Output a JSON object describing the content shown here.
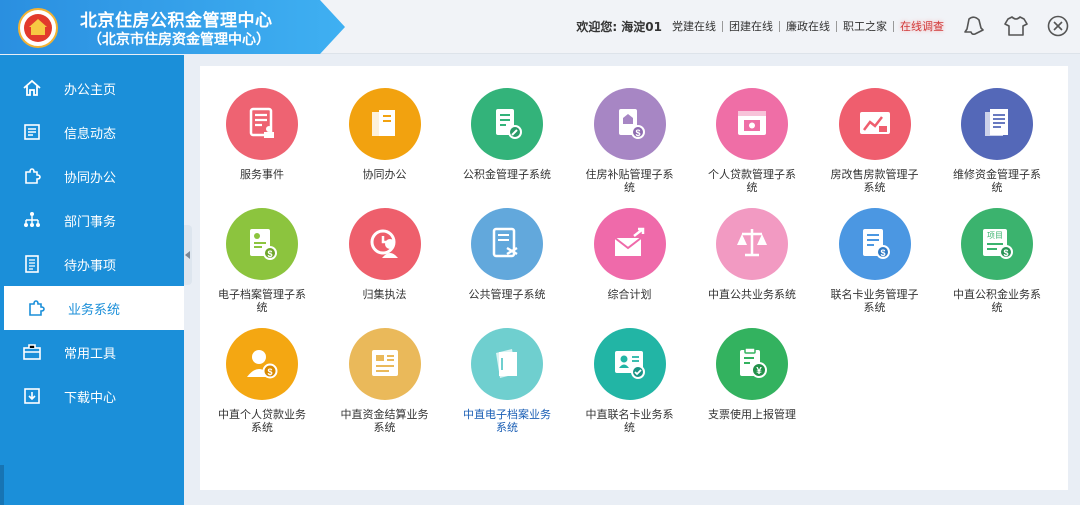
{
  "header": {
    "title": "北京住房公积金管理中心",
    "subtitle": "（北京市住房资金管理中心）",
    "welcome": "欢迎您: 海淀01",
    "links": [
      "党建在线",
      "团建在线",
      "廉政在线",
      "职工之家",
      "在线调查"
    ],
    "icons": [
      "bell-icon",
      "shirt-icon",
      "close-icon"
    ]
  },
  "sidebar": {
    "items": [
      {
        "label": "办公主页",
        "icon": "home-icon"
      },
      {
        "label": "信息动态",
        "icon": "news-icon"
      },
      {
        "label": "协同办公",
        "icon": "puzzle-icon"
      },
      {
        "label": "部门事务",
        "icon": "org-chart-icon"
      },
      {
        "label": "待办事项",
        "icon": "todo-list-icon"
      },
      {
        "label": "业务系统",
        "icon": "puzzle-icon",
        "active": true
      },
      {
        "label": "常用工具",
        "icon": "toolbox-icon"
      },
      {
        "label": "下载中心",
        "icon": "download-icon"
      }
    ]
  },
  "apps": [
    {
      "label": "服务事件",
      "color": "#ee6372",
      "icon": "document-stamp-icon"
    },
    {
      "label": "协同办公",
      "color": "#f2a20f",
      "icon": "folders-icon"
    },
    {
      "label": "公积金管理子系统",
      "color": "#33b37a",
      "icon": "document-edit-icon"
    },
    {
      "label": "住房补贴管理子系统",
      "color": "#a786c4",
      "icon": "house-money-icon"
    },
    {
      "label": "个人贷款管理子系统",
      "color": "#ef6ea6",
      "icon": "web-page-icon"
    },
    {
      "label": "房改售房款管理子系统",
      "color": "#ef5e6e",
      "icon": "chart-board-icon"
    },
    {
      "label": "维修资金管理子系统",
      "color": "#5468b8",
      "icon": "documents-icon"
    },
    {
      "label": "电子档案管理子系统",
      "color": "#8cc43e",
      "icon": "id-money-icon"
    },
    {
      "label": "归集执法",
      "color": "#ee5f6c",
      "icon": "officer-icon"
    },
    {
      "label": "公共管理子系统",
      "color": "#62a8dc",
      "icon": "shuffle-doc-icon"
    },
    {
      "label": "综合计划",
      "color": "#ef6aaa",
      "icon": "envelope-arrow-icon"
    },
    {
      "label": "中直公共业务系统",
      "color": "#f29ac2",
      "icon": "scales-icon"
    },
    {
      "label": "联名卡业务管理子系统",
      "color": "#4b97e2",
      "icon": "card-money-icon"
    },
    {
      "label": "中直公积金业务系统",
      "color": "#3bb36e",
      "icon": "project-money-icon"
    },
    {
      "label": "中直个人贷款业务系统",
      "color": "#f4a712",
      "icon": "person-money-icon"
    },
    {
      "label": "中直资金结算业务系统",
      "color": "#eab95a",
      "icon": "list-doc-icon"
    },
    {
      "label": "中直电子档案业务系统",
      "color": "#6fcfcf",
      "icon": "archive-doc-icon",
      "link": true
    },
    {
      "label": "中直联名卡业务系统",
      "color": "#22b5a5",
      "icon": "id-check-icon"
    },
    {
      "label": "支票使用上报管理",
      "color": "#33b25f",
      "icon": "clipboard-yen-icon"
    }
  ]
}
